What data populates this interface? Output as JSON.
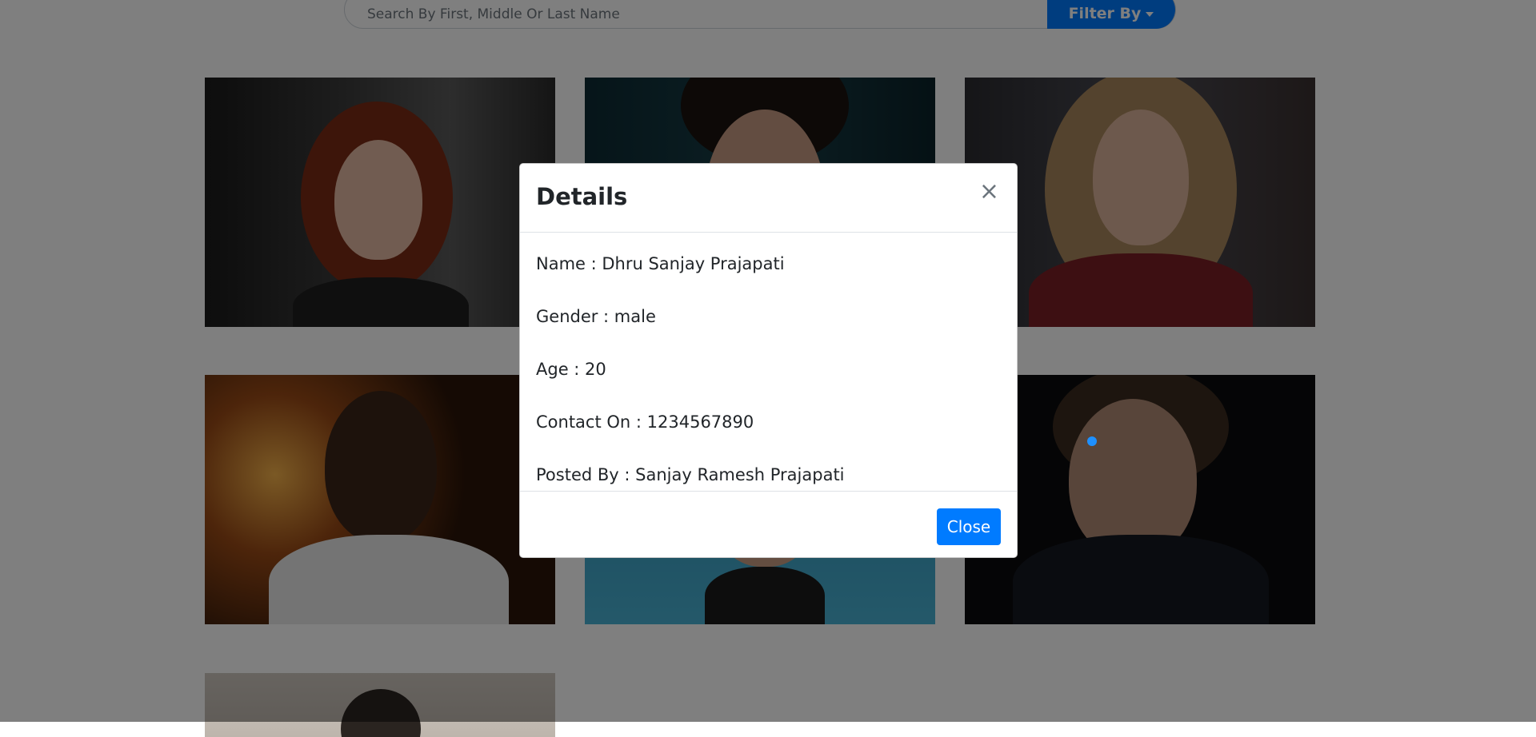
{
  "search": {
    "placeholder": "Search By First, Middle Or Last Name",
    "filter_label": "Filter By"
  },
  "cards": [
    {
      "photo": "portrait-red-hair-woman"
    },
    {
      "photo": "portrait-dark-hair-man"
    },
    {
      "photo": "portrait-blonde-woman"
    },
    {
      "photo": "portrait-man-city-lights"
    },
    {
      "photo": "portrait-man-blue-backdrop"
    },
    {
      "photo": "portrait-man-dark-jacket"
    },
    {
      "photo": "portrait-partial"
    }
  ],
  "modal": {
    "title": "Details",
    "close_icon": "×",
    "lines": [
      "Name : Dhru Sanjay Prajapati",
      "Gender : male",
      "Age : 20",
      "Contact On : 1234567890",
      "Posted By : Sanjay Ramesh Prajapati"
    ],
    "close_label": "Close"
  },
  "colors": {
    "primary": "#007bff",
    "backdrop": "rgba(0,0,0,0.5)"
  }
}
